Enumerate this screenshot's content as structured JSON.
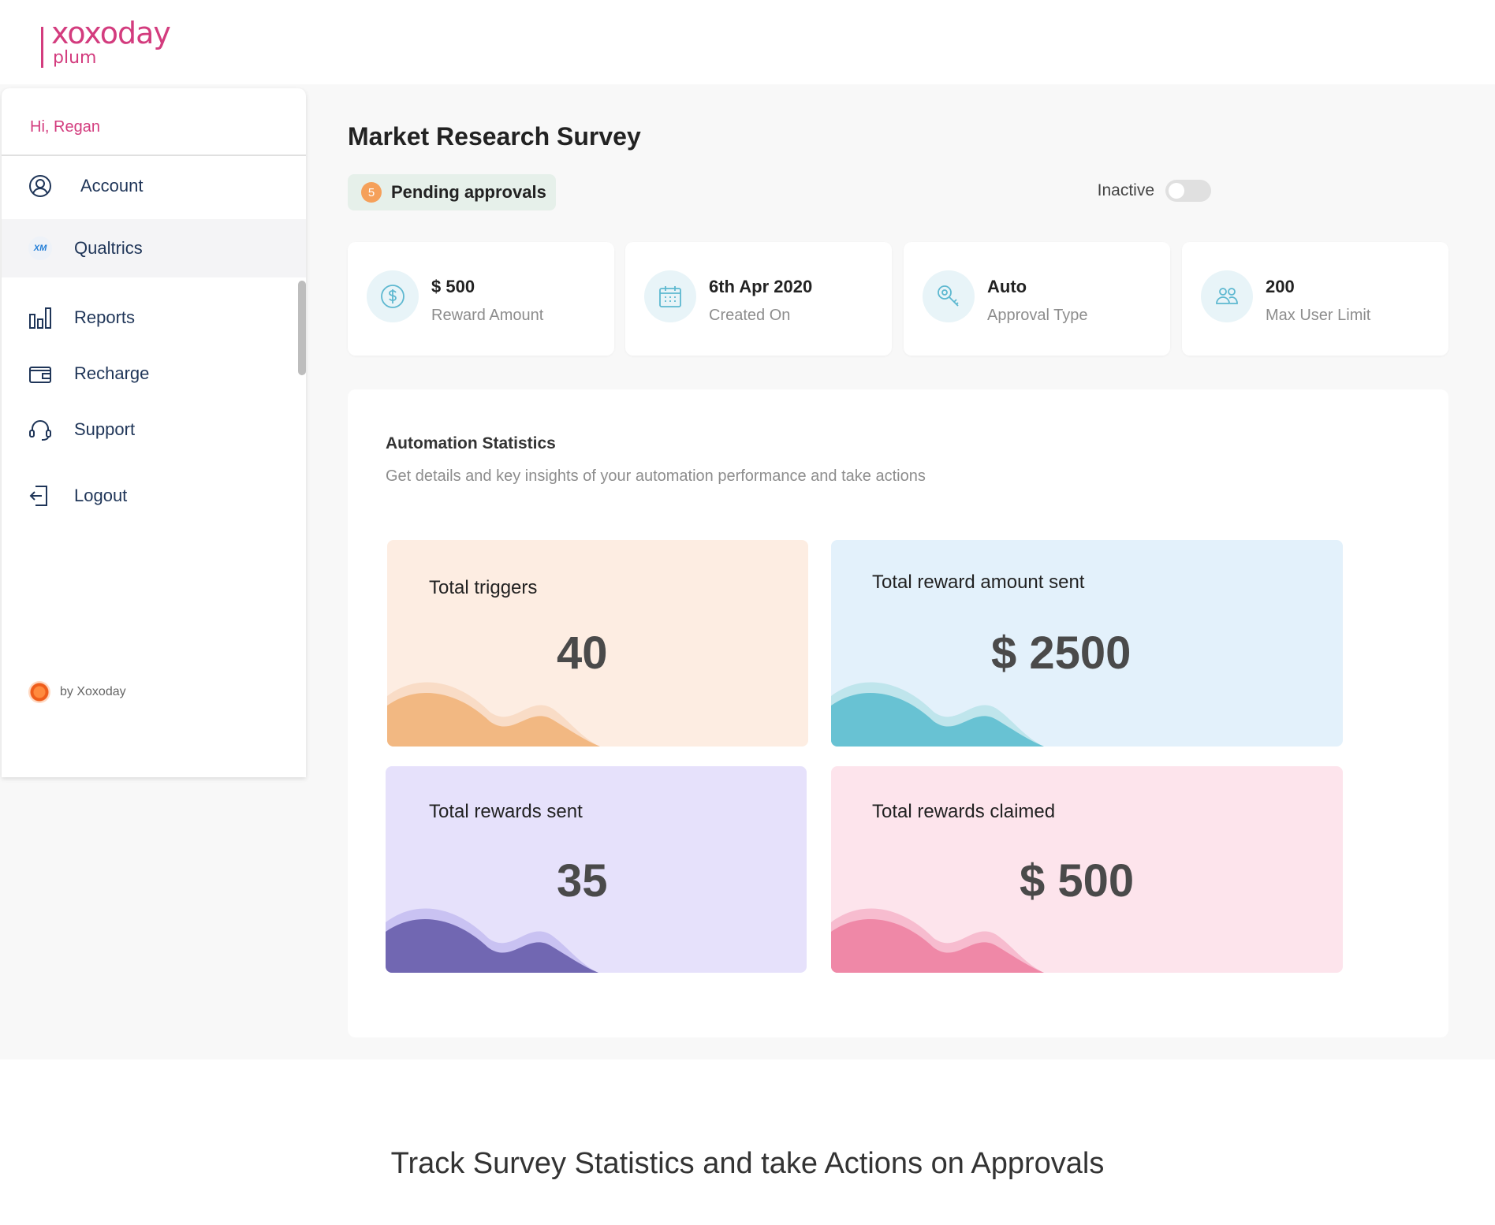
{
  "brand": {
    "name_top": "xoxoday",
    "name_bottom": "plum",
    "color": "#d33c7e"
  },
  "sidebar": {
    "greeting": "Hi, Regan",
    "items": [
      {
        "label": "Account",
        "icon": "user-circle-icon"
      },
      {
        "label": "Qualtrics",
        "icon": "xm-icon",
        "badge": "XM"
      },
      {
        "label": "Reports",
        "icon": "bar-chart-icon"
      },
      {
        "label": "Recharge",
        "icon": "wallet-icon"
      },
      {
        "label": "Support",
        "icon": "headset-icon"
      },
      {
        "label": "Logout",
        "icon": "logout-icon"
      }
    ],
    "active_index": 1,
    "footer": "by Xoxoday"
  },
  "main": {
    "title": "Market Research Survey",
    "pending": {
      "count": "5",
      "label": "Pending approvals"
    },
    "status": {
      "label": "Inactive",
      "enabled": false
    },
    "info_cards": [
      {
        "value": "$ 500",
        "label": "Reward Amount",
        "icon": "dollar-icon"
      },
      {
        "value": "6th Apr 2020",
        "label": "Created On",
        "icon": "calendar-icon"
      },
      {
        "value": "Auto",
        "label": "Approval Type",
        "icon": "key-icon"
      },
      {
        "value": "200",
        "label": "Max User Limit",
        "icon": "users-icon"
      }
    ],
    "stats": {
      "title": "Automation Statistics",
      "subtitle": "Get details and key insights of your automation performance and take actions",
      "cards": [
        {
          "title": "Total triggers",
          "value": "40",
          "bg": "#fdede2",
          "wave": "#f2b882",
          "wave_light": "#f9dcc6"
        },
        {
          "title": "Total reward amount sent",
          "value": "$ 2500",
          "bg": "#e3f1fb",
          "wave": "#68c2d3",
          "wave_light": "#bfe5ec"
        },
        {
          "title": "Total rewards sent",
          "value": "35",
          "bg": "#e6e1fb",
          "wave": "#7167b2",
          "wave_light": "#c9c2f2"
        },
        {
          "title": "Total rewards claimed",
          "value": "$ 500",
          "bg": "#fde4ec",
          "wave": "#ef88a7",
          "wave_light": "#f7bccf"
        }
      ]
    }
  },
  "caption": "Track Survey Statistics and take Actions on Approvals"
}
